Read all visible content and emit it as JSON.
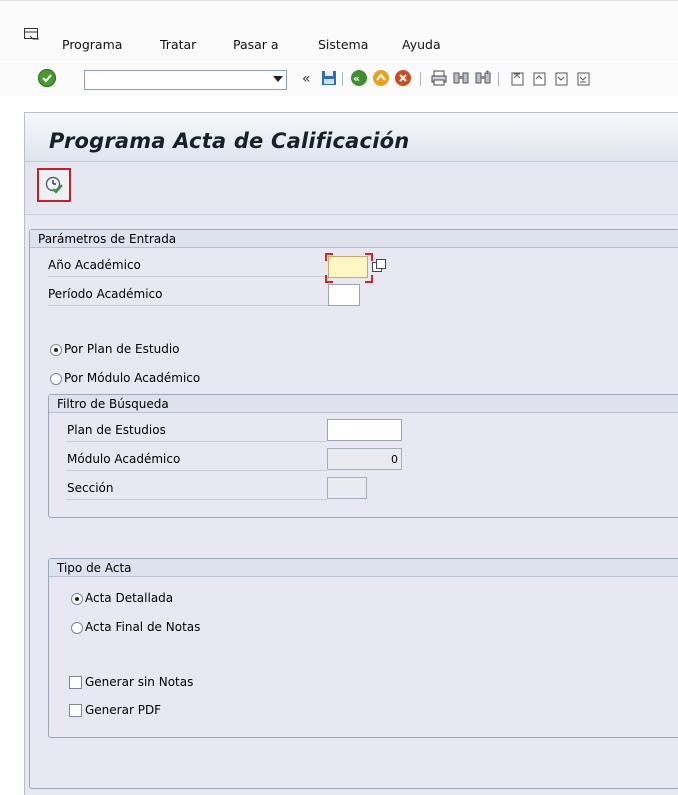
{
  "menu": {
    "items": [
      "Programa",
      "Tratar",
      "Pasar a",
      "Sistema",
      "Ayuda"
    ]
  },
  "toolbar": {
    "command_value": "",
    "icons": [
      "enter-icon",
      "back-arrows-icon",
      "save-icon",
      "back-icon",
      "exit-icon",
      "cancel-icon",
      "print-icon",
      "find-icon",
      "find-next-icon",
      "first-page-icon",
      "previous-page-icon"
    ]
  },
  "app": {
    "title": "Programa Acta de Calificación"
  },
  "params": {
    "title": "Parámetros de Entrada",
    "year_label": "Año Académico",
    "year_value": "",
    "period_label": "Período Académico",
    "period_value": "",
    "radio_plan": "Por Plan de Estudio",
    "radio_module": "Por Módulo Académico",
    "selected_radio": "plan"
  },
  "filter": {
    "title": "Filtro de Búsqueda",
    "plan_label": "Plan de Estudios",
    "plan_value": "",
    "module_label": "Módulo Académico",
    "module_value": "0",
    "section_label": "Sección",
    "section_value": ""
  },
  "acta": {
    "title": "Tipo de Acta",
    "radio_detailed": "Acta Detallada",
    "radio_final": "Acta Final de Notas",
    "selected_radio": "detailed",
    "check_no_notes": "Generar sin Notas",
    "check_pdf": "Generar PDF",
    "no_notes_checked": false,
    "pdf_checked": false
  },
  "colors": {
    "accent_red": "#c81e24",
    "required_field": "#fff6c4",
    "ok_green": "#4a9b2f"
  }
}
